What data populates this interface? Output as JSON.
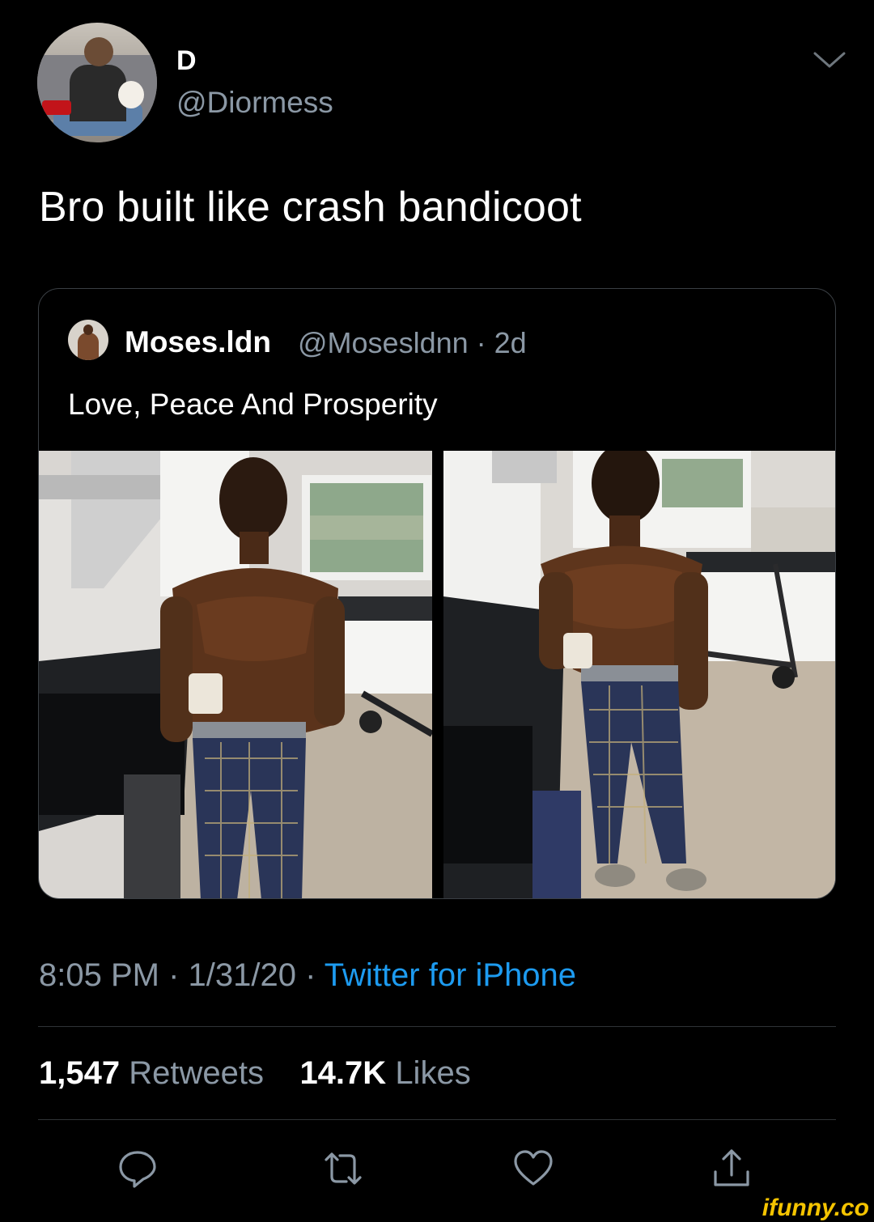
{
  "author": {
    "display_name": "D",
    "handle": "@Diormess"
  },
  "tweet": {
    "text": "Bro built like crash bandicoot"
  },
  "quoted": {
    "display_name": "Moses.ldn",
    "handle_meta": "@Mosesldnn · 2d",
    "text": "Love, Peace And Prosperity"
  },
  "meta": {
    "time_date": "8:05 PM · 1/31/20 · ",
    "source": "Twitter for iPhone"
  },
  "stats": {
    "retweets_count": "1,547",
    "retweets_label": "Retweets",
    "likes_count": "14.7K",
    "likes_label": "Likes"
  },
  "brand": {
    "watermark": "ifunny.co"
  },
  "colors": {
    "background": "#000000",
    "secondary_text": "#8b98a5",
    "link": "#1d9bf0",
    "divider": "#2f3336"
  },
  "icons": {
    "menu": "chevron-down-icon",
    "reply": "reply-icon",
    "retweet": "retweet-icon",
    "like": "heart-icon",
    "share": "share-icon"
  }
}
